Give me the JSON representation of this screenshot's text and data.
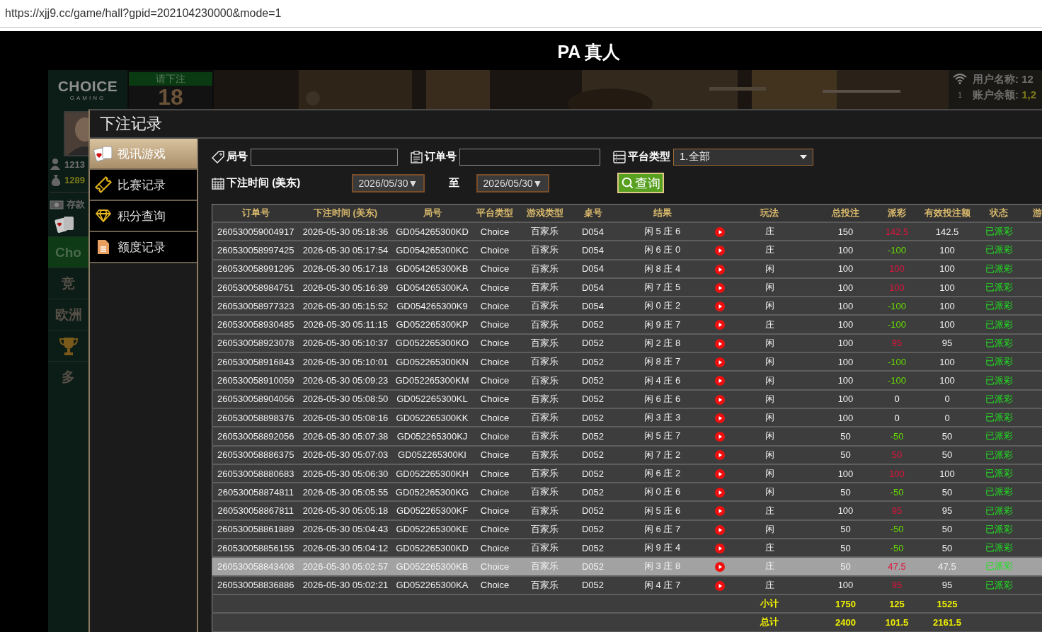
{
  "browser": {
    "url": "https://xjj9.cc/game/hall?gpid=202104230000&mode=1"
  },
  "page_title": "PA 真人",
  "game_backdrop": {
    "logo": "CHOICE",
    "logo_sub": "GAMING",
    "countdown_label": "请下注",
    "countdown": "18",
    "player": {
      "name": "1213",
      "balance": "1289",
      "deposit": "存款"
    },
    "lobby_items": [
      {
        "kind": "text",
        "label": "Cho",
        "selected": true
      },
      {
        "kind": "text",
        "label": "竞",
        "selected": false
      },
      {
        "kind": "text",
        "label": "欧洲",
        "selected": false
      },
      {
        "kind": "trophy",
        "selected": false
      },
      {
        "kind": "text",
        "label": "多",
        "selected": false
      }
    ],
    "signal_channel": "1",
    "info": [
      {
        "label": "用户名称: ",
        "value": "12"
      },
      {
        "label": "账户余额: ",
        "value": "1,2"
      }
    ]
  },
  "modal": {
    "title": "下注记录",
    "menu": [
      {
        "kind": "cards",
        "label": "视讯游戏",
        "selected": true
      },
      {
        "kind": "ticket",
        "label": "比赛记录",
        "selected": false
      },
      {
        "kind": "diamond",
        "label": "积分查询",
        "selected": false
      },
      {
        "kind": "document",
        "label": "额度记录",
        "selected": false
      }
    ],
    "filters": {
      "round_no": {
        "label": "局号"
      },
      "order_no": {
        "label": "订单号"
      },
      "platform": {
        "label": "平台类型",
        "value": "1.全部"
      },
      "bet_time": {
        "label": "下注时间 (美东)",
        "from": "2026/05/30▼",
        "separator": "至",
        "to": "2026/05/30▼"
      },
      "query_button": "查询"
    },
    "table": {
      "columns": [
        {
          "kind": "text",
          "label": "订单号"
        },
        {
          "kind": "text",
          "label": "下注时间 (美东)"
        },
        {
          "kind": "text",
          "label": "局号"
        },
        {
          "kind": "text",
          "label": "平台类型"
        },
        {
          "kind": "text",
          "label": "游戏类型"
        },
        {
          "kind": "text",
          "label": "桌号"
        },
        {
          "kind": "text",
          "label": "结果"
        },
        {
          "kind": "icon"
        },
        {
          "kind": "text",
          "label": "玩法"
        },
        {
          "kind": "text",
          "label": "总投注"
        },
        {
          "kind": "text",
          "label": "派彩"
        },
        {
          "kind": "text",
          "label": "有效投注额"
        },
        {
          "kind": "text",
          "label": "状态"
        },
        {
          "kind": "text",
          "label": "游"
        }
      ],
      "rows": [
        {
          "order": "260530059004917",
          "time": "2026-05-30 05:18:36",
          "round": "GD054265300KD",
          "platform": "Choice",
          "game": "百家乐",
          "table": "D054",
          "result": "闲 5 庄 6",
          "play": "庄",
          "total": "150",
          "payout": {
            "text": "142.5",
            "color": "#e0143c"
          },
          "valid": "142.5",
          "status": "已派彩",
          "selected": false
        },
        {
          "order": "260530058997425",
          "time": "2026-05-30 05:17:54",
          "round": "GD054265300KC",
          "platform": "Choice",
          "game": "百家乐",
          "table": "D054",
          "result": "闲 6 庄 0",
          "play": "庄",
          "total": "100",
          "payout": {
            "text": "-100",
            "color": "#66dd00"
          },
          "valid": "100",
          "status": "已派彩",
          "selected": false
        },
        {
          "order": "260530058991295",
          "time": "2026-05-30 05:17:18",
          "round": "GD054265300KB",
          "platform": "Choice",
          "game": "百家乐",
          "table": "D054",
          "result": "闲 8 庄 4",
          "play": "闲",
          "total": "100",
          "payout": {
            "text": "100",
            "color": "#e0143c"
          },
          "valid": "100",
          "status": "已派彩",
          "selected": false
        },
        {
          "order": "260530058984751",
          "time": "2026-05-30 05:16:39",
          "round": "GD054265300KA",
          "platform": "Choice",
          "game": "百家乐",
          "table": "D054",
          "result": "闲 7 庄 5",
          "play": "闲",
          "total": "100",
          "payout": {
            "text": "100",
            "color": "#e0143c"
          },
          "valid": "100",
          "status": "已派彩",
          "selected": false
        },
        {
          "order": "260530058977323",
          "time": "2026-05-30 05:15:52",
          "round": "GD054265300K9",
          "platform": "Choice",
          "game": "百家乐",
          "table": "D054",
          "result": "闲 0 庄 2",
          "play": "闲",
          "total": "100",
          "payout": {
            "text": "-100",
            "color": "#66dd00"
          },
          "valid": "100",
          "status": "已派彩",
          "selected": false
        },
        {
          "order": "260530058930485",
          "time": "2026-05-30 05:11:15",
          "round": "GD052265300KP",
          "platform": "Choice",
          "game": "百家乐",
          "table": "D052",
          "result": "闲 9 庄 7",
          "play": "庄",
          "total": "100",
          "payout": {
            "text": "-100",
            "color": "#66dd00"
          },
          "valid": "100",
          "status": "已派彩",
          "selected": false
        },
        {
          "order": "260530058923078",
          "time": "2026-05-30 05:10:37",
          "round": "GD052265300KO",
          "platform": "Choice",
          "game": "百家乐",
          "table": "D052",
          "result": "闲 2 庄 8",
          "play": "闲",
          "total": "100",
          "payout": {
            "text": "95",
            "color": "#e0143c"
          },
          "valid": "95",
          "status": "已派彩",
          "selected": false
        },
        {
          "order": "260530058916843",
          "time": "2026-05-30 05:10:01",
          "round": "GD052265300KN",
          "platform": "Choice",
          "game": "百家乐",
          "table": "D052",
          "result": "闲 8 庄 7",
          "play": "闲",
          "total": "100",
          "payout": {
            "text": "-100",
            "color": "#66dd00"
          },
          "valid": "100",
          "status": "已派彩",
          "selected": false
        },
        {
          "order": "260530058910059",
          "time": "2026-05-30 05:09:23",
          "round": "GD052265300KM",
          "platform": "Choice",
          "game": "百家乐",
          "table": "D052",
          "result": "闲 4 庄 6",
          "play": "闲",
          "total": "100",
          "payout": {
            "text": "-100",
            "color": "#66dd00"
          },
          "valid": "100",
          "status": "已派彩",
          "selected": false
        },
        {
          "order": "260530058904056",
          "time": "2026-05-30 05:08:50",
          "round": "GD052265300KL",
          "platform": "Choice",
          "game": "百家乐",
          "table": "D052",
          "result": "闲 6 庄 6",
          "play": "闲",
          "total": "100",
          "payout": {
            "text": "0",
            "color": "#ffffff"
          },
          "valid": "0",
          "status": "已派彩",
          "selected": false
        },
        {
          "order": "260530058898376",
          "time": "2026-05-30 05:08:16",
          "round": "GD052265300KK",
          "platform": "Choice",
          "game": "百家乐",
          "table": "D052",
          "result": "闲 3 庄 3",
          "play": "闲",
          "total": "100",
          "payout": {
            "text": "0",
            "color": "#ffffff"
          },
          "valid": "0",
          "status": "已派彩",
          "selected": false
        },
        {
          "order": "260530058892056",
          "time": "2026-05-30 05:07:38",
          "round": "GD052265300KJ",
          "platform": "Choice",
          "game": "百家乐",
          "table": "D052",
          "result": "闲 5 庄 7",
          "play": "闲",
          "total": "50",
          "payout": {
            "text": "-50",
            "color": "#66dd00"
          },
          "valid": "50",
          "status": "已派彩",
          "selected": false
        },
        {
          "order": "260530058886375",
          "time": "2026-05-30 05:07:03",
          "round": "GD052265300KI",
          "platform": "Choice",
          "game": "百家乐",
          "table": "D052",
          "result": "闲 7 庄 2",
          "play": "闲",
          "total": "50",
          "payout": {
            "text": "50",
            "color": "#e0143c"
          },
          "valid": "50",
          "status": "已派彩",
          "selected": false
        },
        {
          "order": "260530058880683",
          "time": "2026-05-30 05:06:30",
          "round": "GD052265300KH",
          "platform": "Choice",
          "game": "百家乐",
          "table": "D052",
          "result": "闲 6 庄 2",
          "play": "闲",
          "total": "100",
          "payout": {
            "text": "100",
            "color": "#e0143c"
          },
          "valid": "100",
          "status": "已派彩",
          "selected": false
        },
        {
          "order": "260530058874811",
          "time": "2026-05-30 05:05:55",
          "round": "GD052265300KG",
          "platform": "Choice",
          "game": "百家乐",
          "table": "D052",
          "result": "闲 0 庄 6",
          "play": "闲",
          "total": "50",
          "payout": {
            "text": "-50",
            "color": "#66dd00"
          },
          "valid": "50",
          "status": "已派彩",
          "selected": false
        },
        {
          "order": "260530058867811",
          "time": "2026-05-30 05:05:18",
          "round": "GD052265300KF",
          "platform": "Choice",
          "game": "百家乐",
          "table": "D052",
          "result": "闲 5 庄 6",
          "play": "庄",
          "total": "100",
          "payout": {
            "text": "95",
            "color": "#e0143c"
          },
          "valid": "95",
          "status": "已派彩",
          "selected": false
        },
        {
          "order": "260530058861889",
          "time": "2026-05-30 05:04:43",
          "round": "GD052265300KE",
          "platform": "Choice",
          "game": "百家乐",
          "table": "D052",
          "result": "闲 6 庄 7",
          "play": "闲",
          "total": "50",
          "payout": {
            "text": "-50",
            "color": "#66dd00"
          },
          "valid": "50",
          "status": "已派彩",
          "selected": false
        },
        {
          "order": "260530058856155",
          "time": "2026-05-30 05:04:12",
          "round": "GD052265300KD",
          "platform": "Choice",
          "game": "百家乐",
          "table": "D052",
          "result": "闲 9 庄 4",
          "play": "庄",
          "total": "50",
          "payout": {
            "text": "-50",
            "color": "#66dd00"
          },
          "valid": "50",
          "status": "已派彩",
          "selected": false
        },
        {
          "order": "260530058843408",
          "time": "2026-05-30 05:02:57",
          "round": "GD052265300KB",
          "platform": "Choice",
          "game": "百家乐",
          "table": "D052",
          "result": "闲 3 庄 8",
          "play": "庄",
          "total": "50",
          "payout": {
            "text": "47.5",
            "color": "#e0143c"
          },
          "valid": "47.5",
          "status": "已派彩",
          "selected": true
        },
        {
          "order": "260530058836886",
          "time": "2026-05-30 05:02:21",
          "round": "GD052265300KA",
          "platform": "Choice",
          "game": "百家乐",
          "table": "D052",
          "result": "闲 4 庄 7",
          "play": "庄",
          "total": "100",
          "payout": {
            "text": "95",
            "color": "#e0143c"
          },
          "valid": "95",
          "status": "已派彩",
          "selected": false
        }
      ],
      "totals": [
        {
          "label": "小计",
          "total": "1750",
          "payout": "125",
          "valid": "1525"
        },
        {
          "label": "总计",
          "total": "2400",
          "payout": "101.5",
          "valid": "2161.5"
        }
      ]
    }
  }
}
